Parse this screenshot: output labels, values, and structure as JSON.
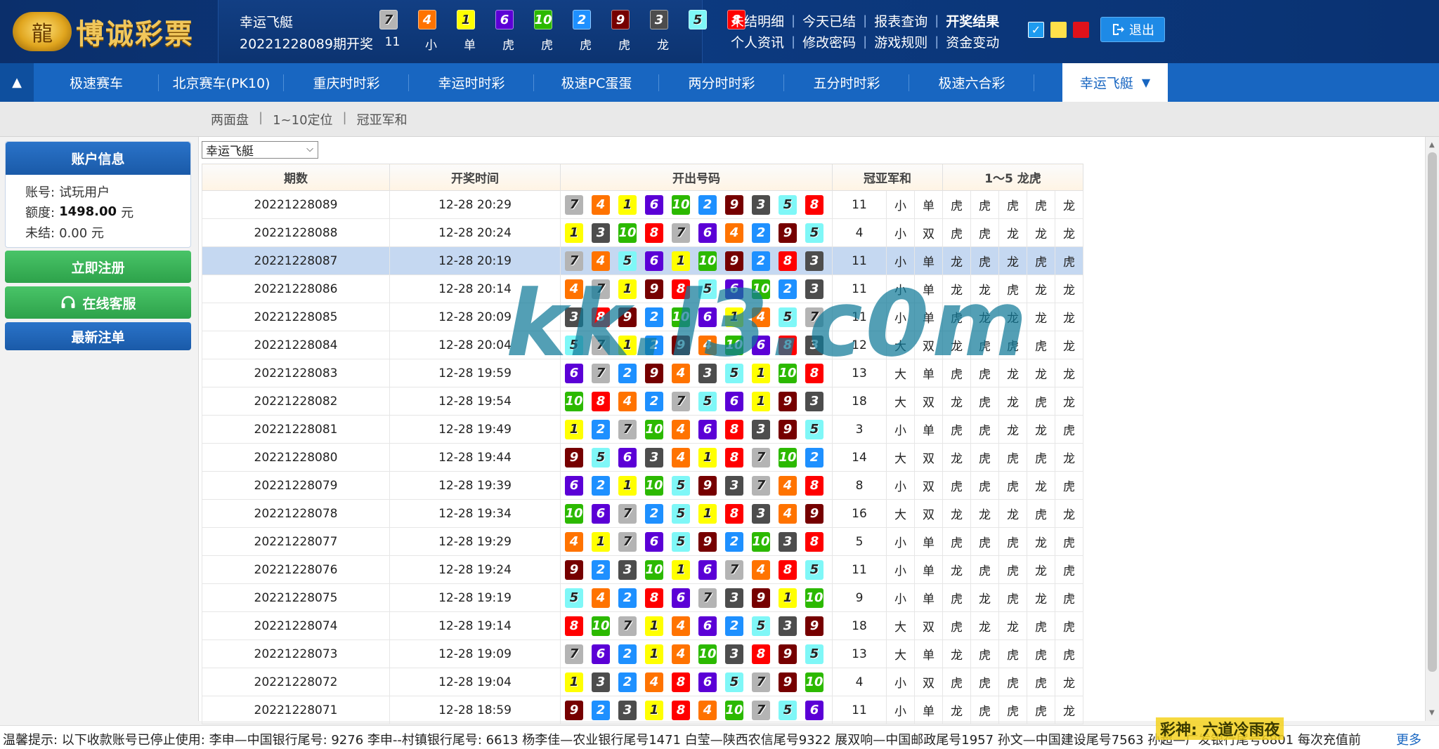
{
  "brand": {
    "name": "博诚彩票"
  },
  "header": {
    "game_name": "幸运飞艇",
    "issue_text": "20221228089期开奖",
    "current_balls": [
      7,
      4,
      1,
      6,
      10,
      2,
      9,
      3,
      5,
      8
    ],
    "current_stats": [
      "11",
      "小",
      "单",
      "虎",
      "虎",
      "虎",
      "虎",
      "龙"
    ],
    "links_row1": [
      "未结明细",
      "今天已结",
      "报表查询",
      "开奖结果"
    ],
    "links_row2": [
      "个人资讯",
      "修改密码",
      "游戏规则",
      "资金变动"
    ],
    "logout_label": "退出",
    "colors": {
      "blue": "#1e9bf0",
      "yellow": "#ffe04a",
      "red": "#e0121a"
    }
  },
  "nav": {
    "items": [
      "极速赛车",
      "北京赛车(PK10)",
      "重庆时时彩",
      "幸运时时彩",
      "极速PC蛋蛋",
      "两分时时彩",
      "五分时时彩",
      "极速六合彩"
    ],
    "active": "幸运飞艇"
  },
  "subnav": [
    "两面盘",
    "1~10定位",
    "冠亚军和"
  ],
  "sidebar": {
    "title": "账户信息",
    "account_label": "账号:",
    "account_value": "试玩用户",
    "credit_label": "额度:",
    "credit_value": "1498.00",
    "credit_unit": "元",
    "pending_label": "未结:",
    "pending_value": "0.00 元",
    "register_button": "立即注册",
    "service_button": "在线客服",
    "latest_button": "最新注单"
  },
  "game_select": {
    "value": "幸运飞艇"
  },
  "table": {
    "headers": [
      "期数",
      "开奖时间",
      "开出号码",
      "冠亚军和",
      "1～5 龙虎"
    ],
    "rows": [
      {
        "issue": "20221228089",
        "time": "12-28 20:29",
        "balls": [
          7,
          4,
          1,
          6,
          10,
          2,
          9,
          3,
          5,
          8
        ],
        "sum": "11",
        "size": "小",
        "parity": "单",
        "dt": [
          "虎",
          "虎",
          "虎",
          "虎",
          "龙"
        ]
      },
      {
        "issue": "20221228088",
        "time": "12-28 20:24",
        "balls": [
          1,
          3,
          10,
          8,
          7,
          6,
          4,
          2,
          9,
          5
        ],
        "sum": "4",
        "size": "小",
        "parity": "双",
        "dt": [
          "虎",
          "虎",
          "龙",
          "龙",
          "龙"
        ]
      },
      {
        "issue": "20221228087",
        "time": "12-28 20:19",
        "balls": [
          7,
          4,
          5,
          6,
          1,
          10,
          9,
          2,
          8,
          3
        ],
        "sum": "11",
        "size": "小",
        "parity": "单",
        "dt": [
          "龙",
          "虎",
          "龙",
          "虎",
          "虎"
        ],
        "highlight": true
      },
      {
        "issue": "20221228086",
        "time": "12-28 20:14",
        "balls": [
          4,
          7,
          1,
          9,
          8,
          5,
          6,
          10,
          2,
          3
        ],
        "sum": "11",
        "size": "小",
        "parity": "单",
        "dt": [
          "龙",
          "龙",
          "虎",
          "龙",
          "龙"
        ]
      },
      {
        "issue": "20221228085",
        "time": "12-28 20:09",
        "balls": [
          3,
          8,
          9,
          2,
          10,
          6,
          1,
          4,
          5,
          7
        ],
        "sum": "11",
        "size": "小",
        "parity": "单",
        "dt": [
          "虎",
          "龙",
          "龙",
          "龙",
          "龙"
        ]
      },
      {
        "issue": "20221228084",
        "time": "12-28 20:04",
        "balls": [
          5,
          7,
          1,
          2,
          9,
          4,
          10,
          6,
          8,
          3
        ],
        "sum": "12",
        "size": "大",
        "parity": "双",
        "dt": [
          "龙",
          "虎",
          "虎",
          "虎",
          "龙"
        ]
      },
      {
        "issue": "20221228083",
        "time": "12-28 19:59",
        "balls": [
          6,
          7,
          2,
          9,
          4,
          3,
          5,
          1,
          10,
          8
        ],
        "sum": "13",
        "size": "大",
        "parity": "单",
        "dt": [
          "虎",
          "虎",
          "龙",
          "龙",
          "龙"
        ]
      },
      {
        "issue": "20221228082",
        "time": "12-28 19:54",
        "balls": [
          10,
          8,
          4,
          2,
          7,
          5,
          6,
          1,
          9,
          3
        ],
        "sum": "18",
        "size": "大",
        "parity": "双",
        "dt": [
          "龙",
          "虎",
          "龙",
          "虎",
          "龙"
        ]
      },
      {
        "issue": "20221228081",
        "time": "12-28 19:49",
        "balls": [
          1,
          2,
          7,
          10,
          4,
          6,
          8,
          3,
          9,
          5
        ],
        "sum": "3",
        "size": "小",
        "parity": "单",
        "dt": [
          "虎",
          "虎",
          "龙",
          "龙",
          "虎"
        ]
      },
      {
        "issue": "20221228080",
        "time": "12-28 19:44",
        "balls": [
          9,
          5,
          6,
          3,
          4,
          1,
          8,
          7,
          10,
          2
        ],
        "sum": "14",
        "size": "大",
        "parity": "双",
        "dt": [
          "龙",
          "虎",
          "虎",
          "虎",
          "龙"
        ]
      },
      {
        "issue": "20221228079",
        "time": "12-28 19:39",
        "balls": [
          6,
          2,
          1,
          10,
          5,
          9,
          3,
          7,
          4,
          8
        ],
        "sum": "8",
        "size": "小",
        "parity": "双",
        "dt": [
          "虎",
          "虎",
          "虎",
          "龙",
          "虎"
        ]
      },
      {
        "issue": "20221228078",
        "time": "12-28 19:34",
        "balls": [
          10,
          6,
          7,
          2,
          5,
          1,
          8,
          3,
          4,
          9
        ],
        "sum": "16",
        "size": "大",
        "parity": "双",
        "dt": [
          "龙",
          "龙",
          "龙",
          "虎",
          "龙"
        ]
      },
      {
        "issue": "20221228077",
        "time": "12-28 19:29",
        "balls": [
          4,
          1,
          7,
          6,
          5,
          9,
          2,
          10,
          3,
          8
        ],
        "sum": "5",
        "size": "小",
        "parity": "单",
        "dt": [
          "虎",
          "虎",
          "虎",
          "龙",
          "虎"
        ]
      },
      {
        "issue": "20221228076",
        "time": "12-28 19:24",
        "balls": [
          9,
          2,
          3,
          10,
          1,
          6,
          7,
          4,
          8,
          5
        ],
        "sum": "11",
        "size": "小",
        "parity": "单",
        "dt": [
          "龙",
          "虎",
          "虎",
          "龙",
          "虎"
        ]
      },
      {
        "issue": "20221228075",
        "time": "12-28 19:19",
        "balls": [
          5,
          4,
          2,
          8,
          6,
          7,
          3,
          9,
          1,
          10
        ],
        "sum": "9",
        "size": "小",
        "parity": "单",
        "dt": [
          "虎",
          "龙",
          "虎",
          "龙",
          "虎"
        ]
      },
      {
        "issue": "20221228074",
        "time": "12-28 19:14",
        "balls": [
          8,
          10,
          7,
          1,
          4,
          6,
          2,
          5,
          3,
          9
        ],
        "sum": "18",
        "size": "大",
        "parity": "双",
        "dt": [
          "虎",
          "龙",
          "龙",
          "虎",
          "虎"
        ]
      },
      {
        "issue": "20221228073",
        "time": "12-28 19:09",
        "balls": [
          7,
          6,
          2,
          1,
          4,
          10,
          3,
          8,
          9,
          5
        ],
        "sum": "13",
        "size": "大",
        "parity": "单",
        "dt": [
          "龙",
          "虎",
          "虎",
          "虎",
          "虎"
        ]
      },
      {
        "issue": "20221228072",
        "time": "12-28 19:04",
        "balls": [
          1,
          3,
          2,
          4,
          8,
          6,
          5,
          7,
          9,
          10
        ],
        "sum": "4",
        "size": "小",
        "parity": "双",
        "dt": [
          "虎",
          "虎",
          "虎",
          "虎",
          "龙"
        ]
      },
      {
        "issue": "20221228071",
        "time": "12-28 18:59",
        "balls": [
          9,
          2,
          3,
          1,
          8,
          4,
          10,
          7,
          5,
          6
        ],
        "sum": "11",
        "size": "小",
        "parity": "单",
        "dt": [
          "龙",
          "虎",
          "虎",
          "虎",
          "龙"
        ]
      }
    ]
  },
  "ball_colors": {
    "1": "#ffff00",
    "2": "#1e90ff",
    "3": "#4d4d4d",
    "4": "#ff7300",
    "5": "#7ff7f7",
    "6": "#5b00d6",
    "7": "#b4b4b4",
    "8": "#ff0000",
    "9": "#760000",
    "10": "#2cb900"
  },
  "watermark": "kk.l3.c0m",
  "ticker": {
    "text": "温馨提示: 以下收款账号已停止使用: 李申—中国银行尾号: 9276 李申--村镇银行尾号: 6613 杨李佳—农业银行尾号1471 白莹—陕西农信尾号9322 展双响—中国邮政尾号1957 孙文—中国建设尾号7563 孙超—广发银行尾号6801 每次充值前",
    "more": "更多",
    "tag": "彩神: 六道冷雨夜"
  }
}
